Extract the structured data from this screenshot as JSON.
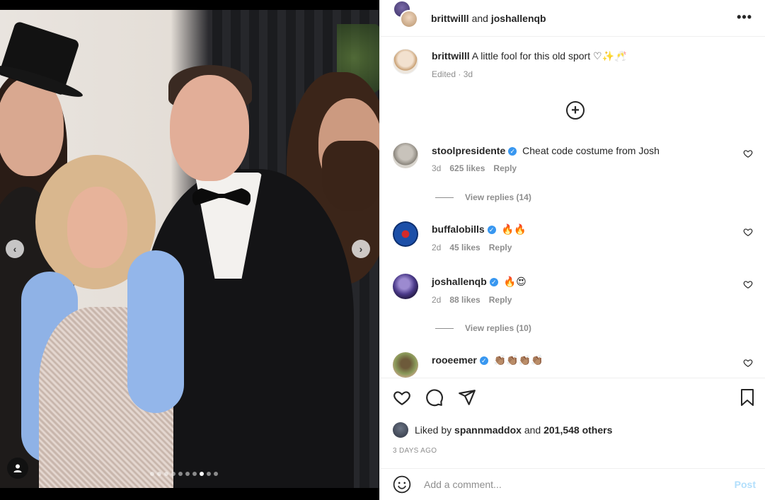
{
  "post": {
    "carousel": {
      "dot_count": 10,
      "active_index": 7
    }
  },
  "header": {
    "author1": "brittwilll",
    "and_text": "and",
    "author2": "joshallenqb",
    "more_icon": "more-horizontal-icon"
  },
  "caption": {
    "username": "brittwilll",
    "text": "A little fool for this old sport ",
    "emoji": "♡✨🥂",
    "edited": "Edited",
    "time": "3d"
  },
  "comments": [
    {
      "username": "stoolpresidente",
      "verified": true,
      "text": "Cheat code costume from Josh",
      "time": "3d",
      "likes": "625 likes",
      "reply": "Reply",
      "view_replies": "View replies (14)"
    },
    {
      "username": "buffalobills",
      "verified": true,
      "text": "🔥🔥",
      "time": "2d",
      "likes": "45 likes",
      "reply": "Reply"
    },
    {
      "username": "joshallenqb",
      "verified": true,
      "text": "🔥😍",
      "time": "2d",
      "likes": "88 likes",
      "reply": "Reply",
      "view_replies": "View replies (10)"
    },
    {
      "username": "rooeemer",
      "verified": true,
      "text": "👏🏽👏🏽👏🏽👏🏽"
    }
  ],
  "likes": {
    "prefix": "Liked by",
    "user": "spannmaddox",
    "and_text": "and",
    "others": "201,548 others"
  },
  "timestamp": "3 DAYS AGO",
  "add_comment": {
    "placeholder": "Add a comment...",
    "post_label": "Post"
  },
  "colors": {
    "verified": "#3897f0",
    "post_disabled": "#b2dffc",
    "muted": "#8e8e8e"
  }
}
